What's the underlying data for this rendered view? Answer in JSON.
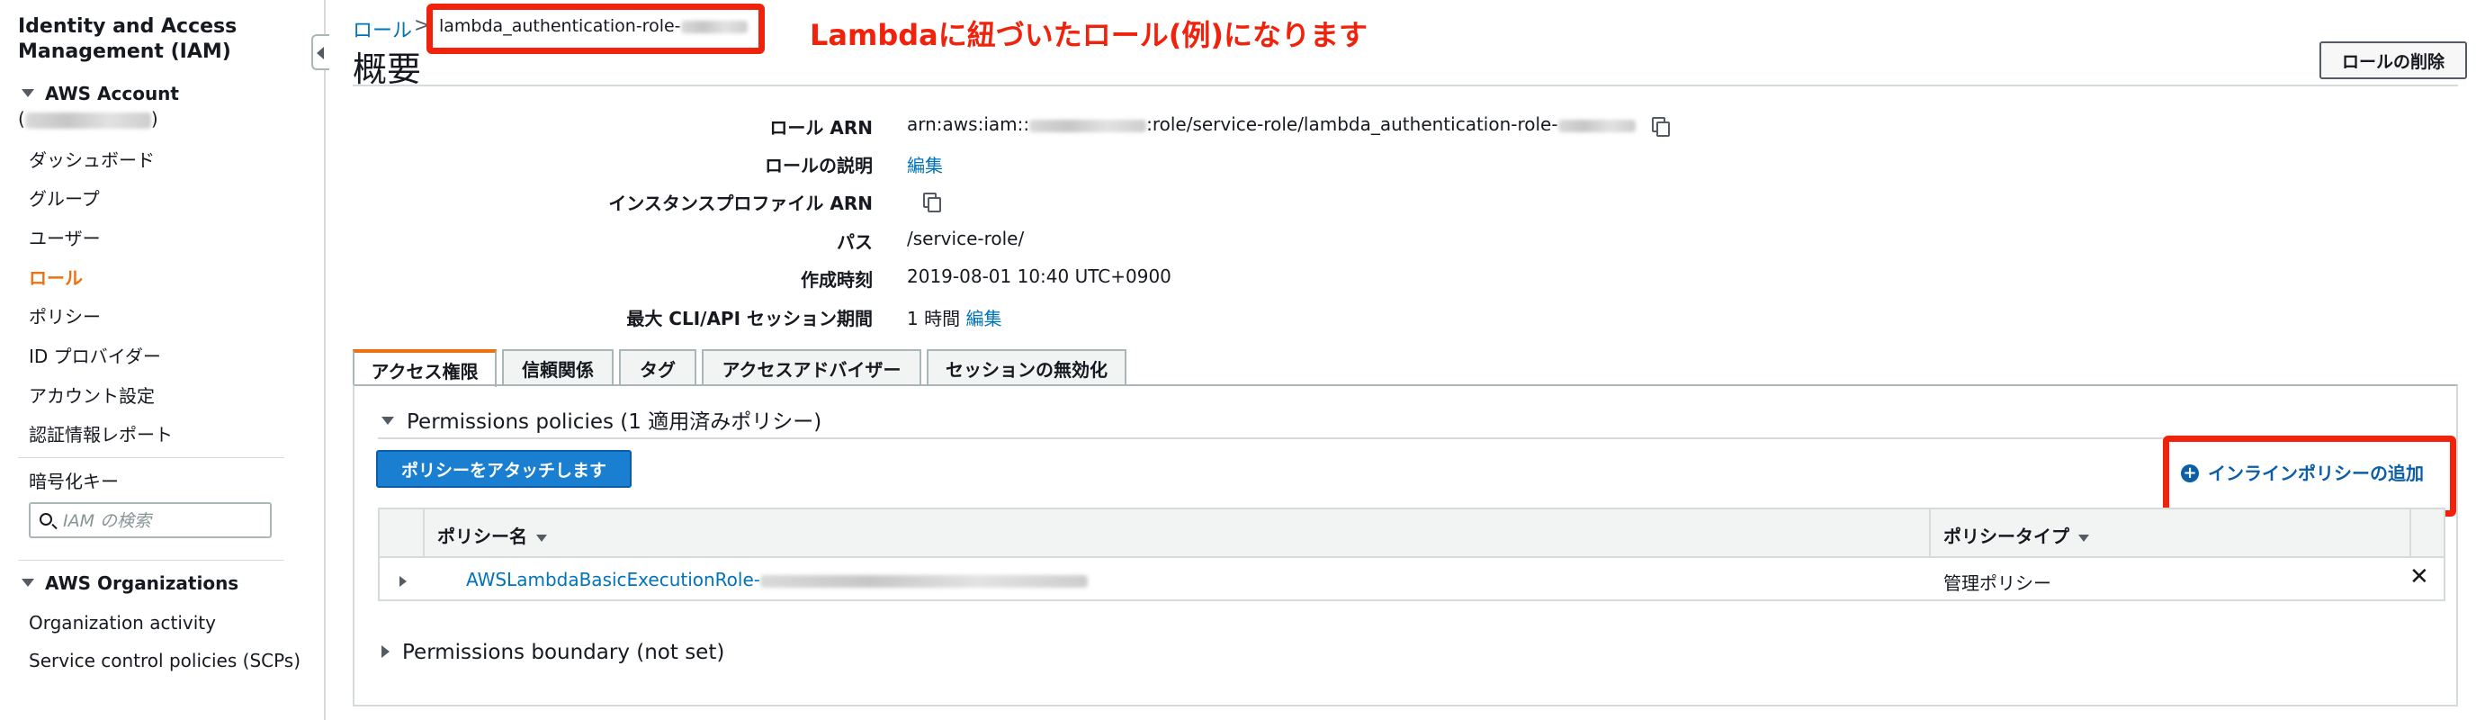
{
  "sidebar": {
    "title": "Identity and Access Management (IAM)",
    "account_section": "AWS Account",
    "account_id_open": "(",
    "account_id_close": ")",
    "items": [
      {
        "label": "ダッシュボード"
      },
      {
        "label": "グループ"
      },
      {
        "label": "ユーザー"
      },
      {
        "label": "ロール"
      },
      {
        "label": "ポリシー"
      },
      {
        "label": "ID プロバイダー"
      },
      {
        "label": "アカウント設定"
      },
      {
        "label": "認証情報レポート"
      }
    ],
    "encryption_label": "暗号化キー",
    "search_placeholder": "IAM の検索",
    "org_section": "AWS Organizations",
    "org_items": [
      {
        "label": "Organization activity"
      },
      {
        "label": "Service control policies (SCPs)"
      }
    ]
  },
  "breadcrumb": {
    "parent": "ロール",
    "separator": ">",
    "current": "lambda_authentication-role-"
  },
  "annotation": "Lambdaに紐づいたロール(例)になります",
  "page_title": "概要",
  "delete_button": "ロールの削除",
  "summary": {
    "role_arn_label": "ロール ARN",
    "role_arn_prefix": "arn:aws:iam::",
    "role_arn_suffix": ":role/service-role/lambda_authentication-role-",
    "description_label": "ロールの説明",
    "description_link": "編集",
    "instance_profile_label": "インスタンスプロファイル ARN",
    "path_label": "パス",
    "path_value": "/service-role/",
    "created_label": "作成時刻",
    "created_value": "2019-08-01 10:40 UTC+0900",
    "session_label": "最大 CLI/API セッション期間",
    "session_value": "1 時間",
    "session_edit": "編集"
  },
  "tabs": [
    {
      "label": "アクセス権限"
    },
    {
      "label": "信頼関係"
    },
    {
      "label": "タグ"
    },
    {
      "label": "アクセスアドバイザー"
    },
    {
      "label": "セッションの無効化"
    }
  ],
  "permissions": {
    "header": "Permissions policies (1 適用済みポリシー)",
    "attach_button": "ポリシーをアタッチします",
    "add_inline": "インラインポリシーの追加",
    "columns": [
      "ポリシー名",
      "ポリシータイプ"
    ],
    "rows": [
      {
        "name": "AWSLambdaBasicExecutionRole-",
        "type": "管理ポリシー"
      }
    ],
    "boundary": "Permissions boundary (not set)"
  },
  "colors": {
    "accent_orange": "#ec7211",
    "link_blue": "#0073bb",
    "annotation_red": "#f1220c",
    "primary_button": "#1a7fd1"
  },
  "icons": [
    "collapse-arrow-icon",
    "caret-down-icon",
    "search-icon",
    "copy-icon",
    "plus-circle-icon",
    "sort-caret-icon",
    "expand-arrow-icon",
    "remove-icon"
  ]
}
